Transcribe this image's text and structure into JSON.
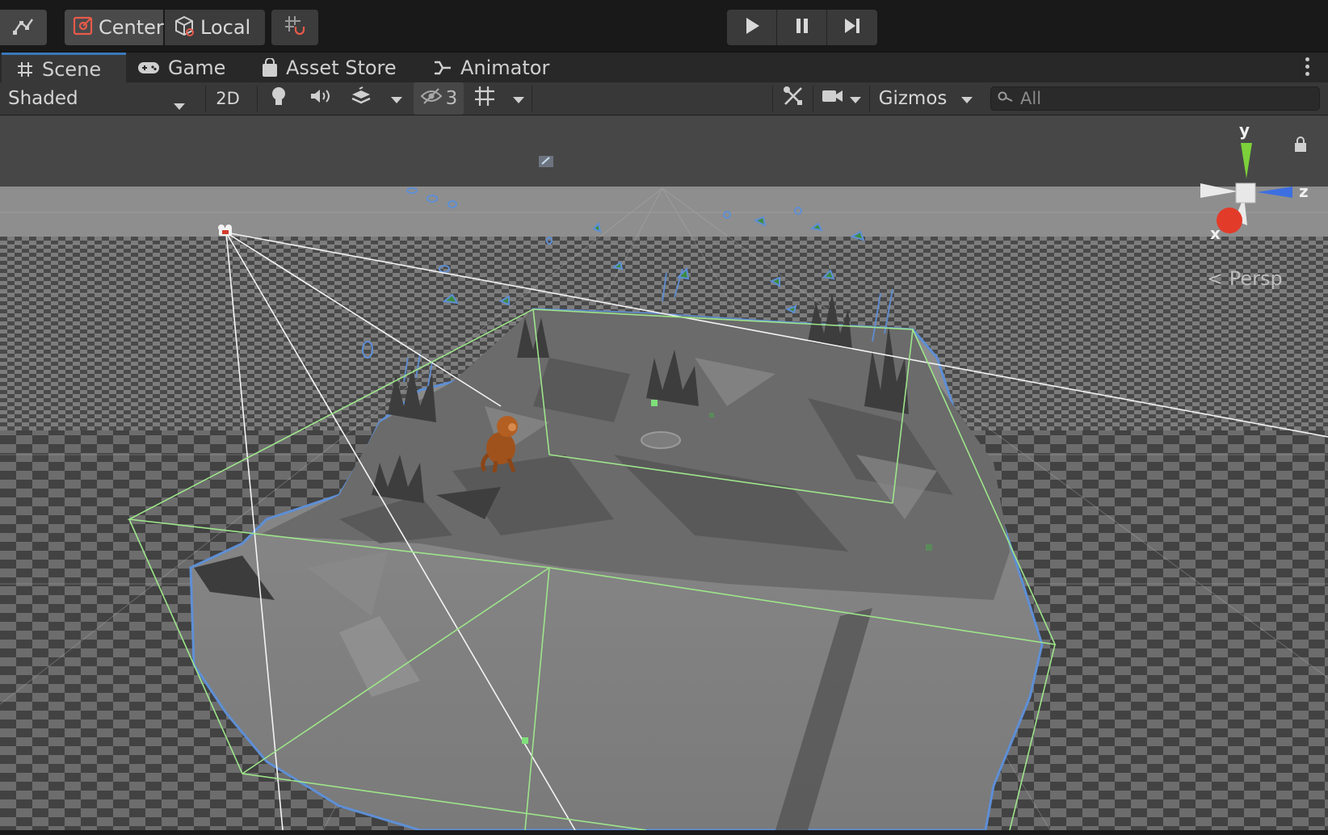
{
  "toolbar": {
    "center_label": "Center",
    "local_label": "Local",
    "icons": [
      "hand-tool-icon",
      "pivot-center-icon",
      "pivot-local-cube-icon",
      "grid-snap-icon",
      "play-icon",
      "pause-icon",
      "step-icon"
    ]
  },
  "tabs": [
    {
      "label": "Scene",
      "icon": "grid-hash-icon",
      "active": true
    },
    {
      "label": "Game",
      "icon": "gamepad-icon",
      "active": false
    },
    {
      "label": "Asset Store",
      "icon": "shopping-bag-icon",
      "active": false
    },
    {
      "label": "Animator",
      "icon": "animator-icon",
      "active": false
    }
  ],
  "scene_toolbar": {
    "draw_mode": "Shaded",
    "mode_2d": "2D",
    "hidden_count": "3",
    "gizmos_label": "Gizmos",
    "search_placeholder": "All",
    "icons": [
      "lighting-bulb-icon",
      "audio-speaker-icon",
      "effects-layers-icon",
      "visibility-eye-slash-icon",
      "grid-toggle-icon",
      "tools-icon",
      "camera-icon",
      "search-icon"
    ]
  },
  "viewport": {
    "projection_label": "Persp",
    "axes": {
      "y": "y",
      "z": "z",
      "x": "x"
    },
    "colors": {
      "x_axis": "#e33b2a",
      "y_axis": "#7cd03a",
      "z_axis": "#3d6fe0",
      "bounds": "#9ee58a",
      "outline": "#5e8fd6"
    }
  }
}
